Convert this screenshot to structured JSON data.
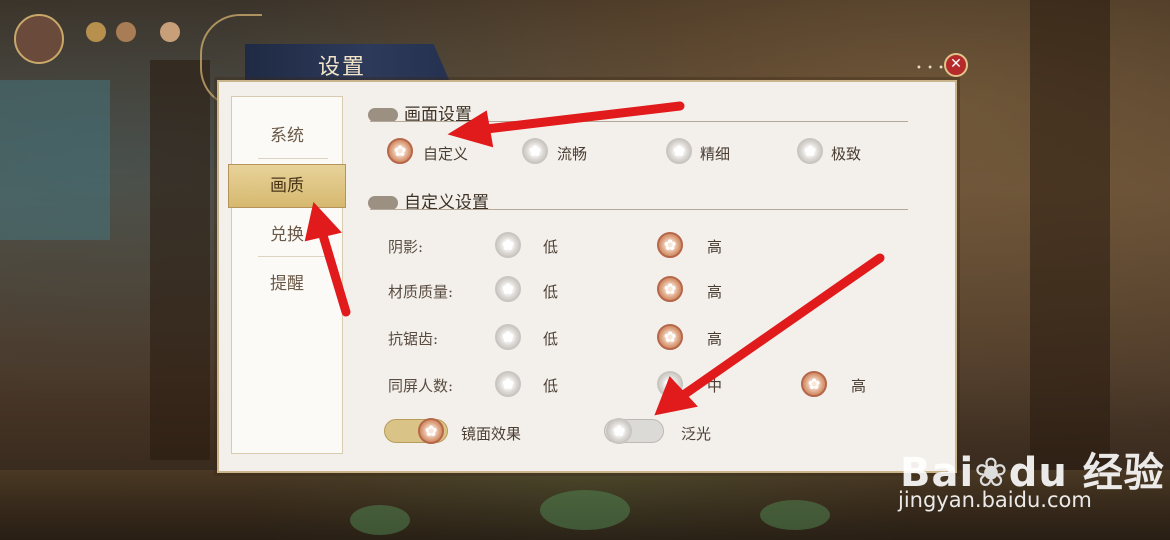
{
  "window": {
    "title": "设置",
    "close_icon": "close-icon"
  },
  "sidebar": {
    "items": [
      {
        "label": "系统",
        "active": false
      },
      {
        "label": "画质",
        "active": true
      },
      {
        "label": "兑换",
        "active": false
      },
      {
        "label": "提醒",
        "active": false
      }
    ]
  },
  "preset_section": {
    "title": "画面设置",
    "options": [
      {
        "label": "自定义",
        "selected": true
      },
      {
        "label": "流畅",
        "selected": false
      },
      {
        "label": "精细",
        "selected": false
      },
      {
        "label": "极致",
        "selected": false
      }
    ]
  },
  "custom_section": {
    "title": "自定义设置",
    "rows": [
      {
        "label": "阴影:",
        "options": [
          {
            "label": "低",
            "selected": false
          },
          {
            "label": "高",
            "selected": true
          }
        ]
      },
      {
        "label": "材质质量:",
        "options": [
          {
            "label": "低",
            "selected": false
          },
          {
            "label": "高",
            "selected": true
          }
        ]
      },
      {
        "label": "抗锯齿:",
        "options": [
          {
            "label": "低",
            "selected": false
          },
          {
            "label": "高",
            "selected": true
          }
        ]
      },
      {
        "label": "同屏人数:",
        "options": [
          {
            "label": "低",
            "selected": false
          },
          {
            "label": "中",
            "selected": false
          },
          {
            "label": "高",
            "selected": true
          }
        ]
      }
    ],
    "toggles": [
      {
        "label": "镜面效果",
        "on": true
      },
      {
        "label": "泛光",
        "on": false
      }
    ]
  },
  "watermark": {
    "logo": "Bai du 经验",
    "url": "jingyan.baidu.com"
  },
  "colors": {
    "selected": "#c2724e",
    "accent": "#d6b96f",
    "annotation_arrow": "#e11b1b"
  }
}
